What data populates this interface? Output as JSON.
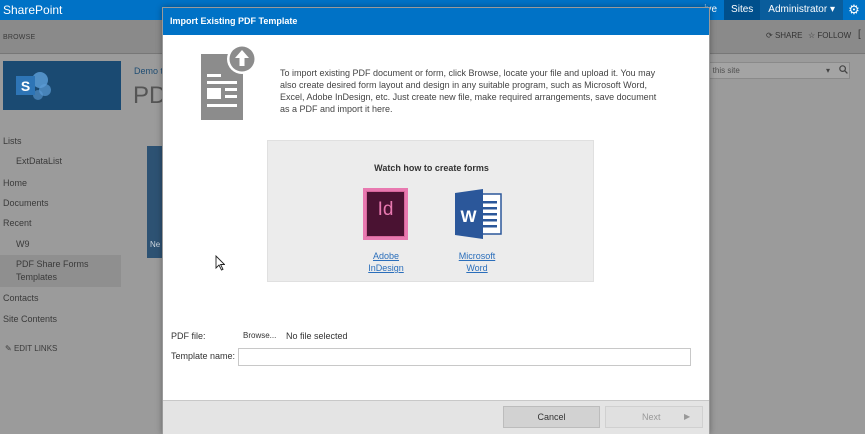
{
  "suite_bar": {
    "brand": "SharePoint",
    "links": [
      {
        "label": "ive",
        "active": false
      },
      {
        "label": "Sites",
        "active": true
      }
    ],
    "user": "Administrator ▾",
    "settings_icon": "gear-icon"
  },
  "ribbon": {
    "browse_tab": "BROWSE",
    "share": "SHARE",
    "follow": "FOLLOW"
  },
  "site": {
    "breadcrumb": "Demo t",
    "title": "PDF",
    "search_placeholder": "h this site",
    "tile_label": "Ne"
  },
  "left_nav": {
    "items": [
      {
        "label": "Lists",
        "level": 0
      },
      {
        "label": "ExtDataList",
        "level": 1
      },
      {
        "label": "Home",
        "level": 0
      },
      {
        "label": "Documents",
        "level": 0
      },
      {
        "label": "Recent",
        "level": 0
      },
      {
        "label": "W9",
        "level": 1
      },
      {
        "label": "PDF Share Forms Templates",
        "level": 1,
        "selected": true
      },
      {
        "label": "Contacts",
        "level": 0
      },
      {
        "label": "Site Contents",
        "level": 0
      }
    ],
    "edit_links": "EDIT LINKS"
  },
  "modal": {
    "title": "Import Existing PDF Template",
    "intro": "To import existing PDF document or form, click Browse, locate your file and upload it. You may also create desired form layout and design in any suitable program, such as Microsoft Word, Excel, Adobe InDesign, etc. Just create new file, make required arrangements, save document as a PDF and import it here.",
    "video_heading": "Watch how to create forms",
    "apps": [
      {
        "line1": "Adobe",
        "line2": "InDesign",
        "icon": "adobe-indesign-icon",
        "glyph": "Id"
      },
      {
        "line1": "Microsoft",
        "line2": "Word",
        "icon": "microsoft-word-icon",
        "glyph": "W"
      }
    ],
    "pdf_file_label": "PDF file:",
    "browse_label": "Browse...",
    "file_status": "No file selected",
    "template_name_label": "Template name:",
    "template_name_value": "",
    "cancel_label": "Cancel",
    "next_label": "Next",
    "next_arrow": "▶"
  },
  "colors": {
    "suite_blue": "#0072c6",
    "link_blue": "#2a6ebb",
    "indesign_pink": "#e879b0",
    "word_blue": "#2b579a"
  }
}
